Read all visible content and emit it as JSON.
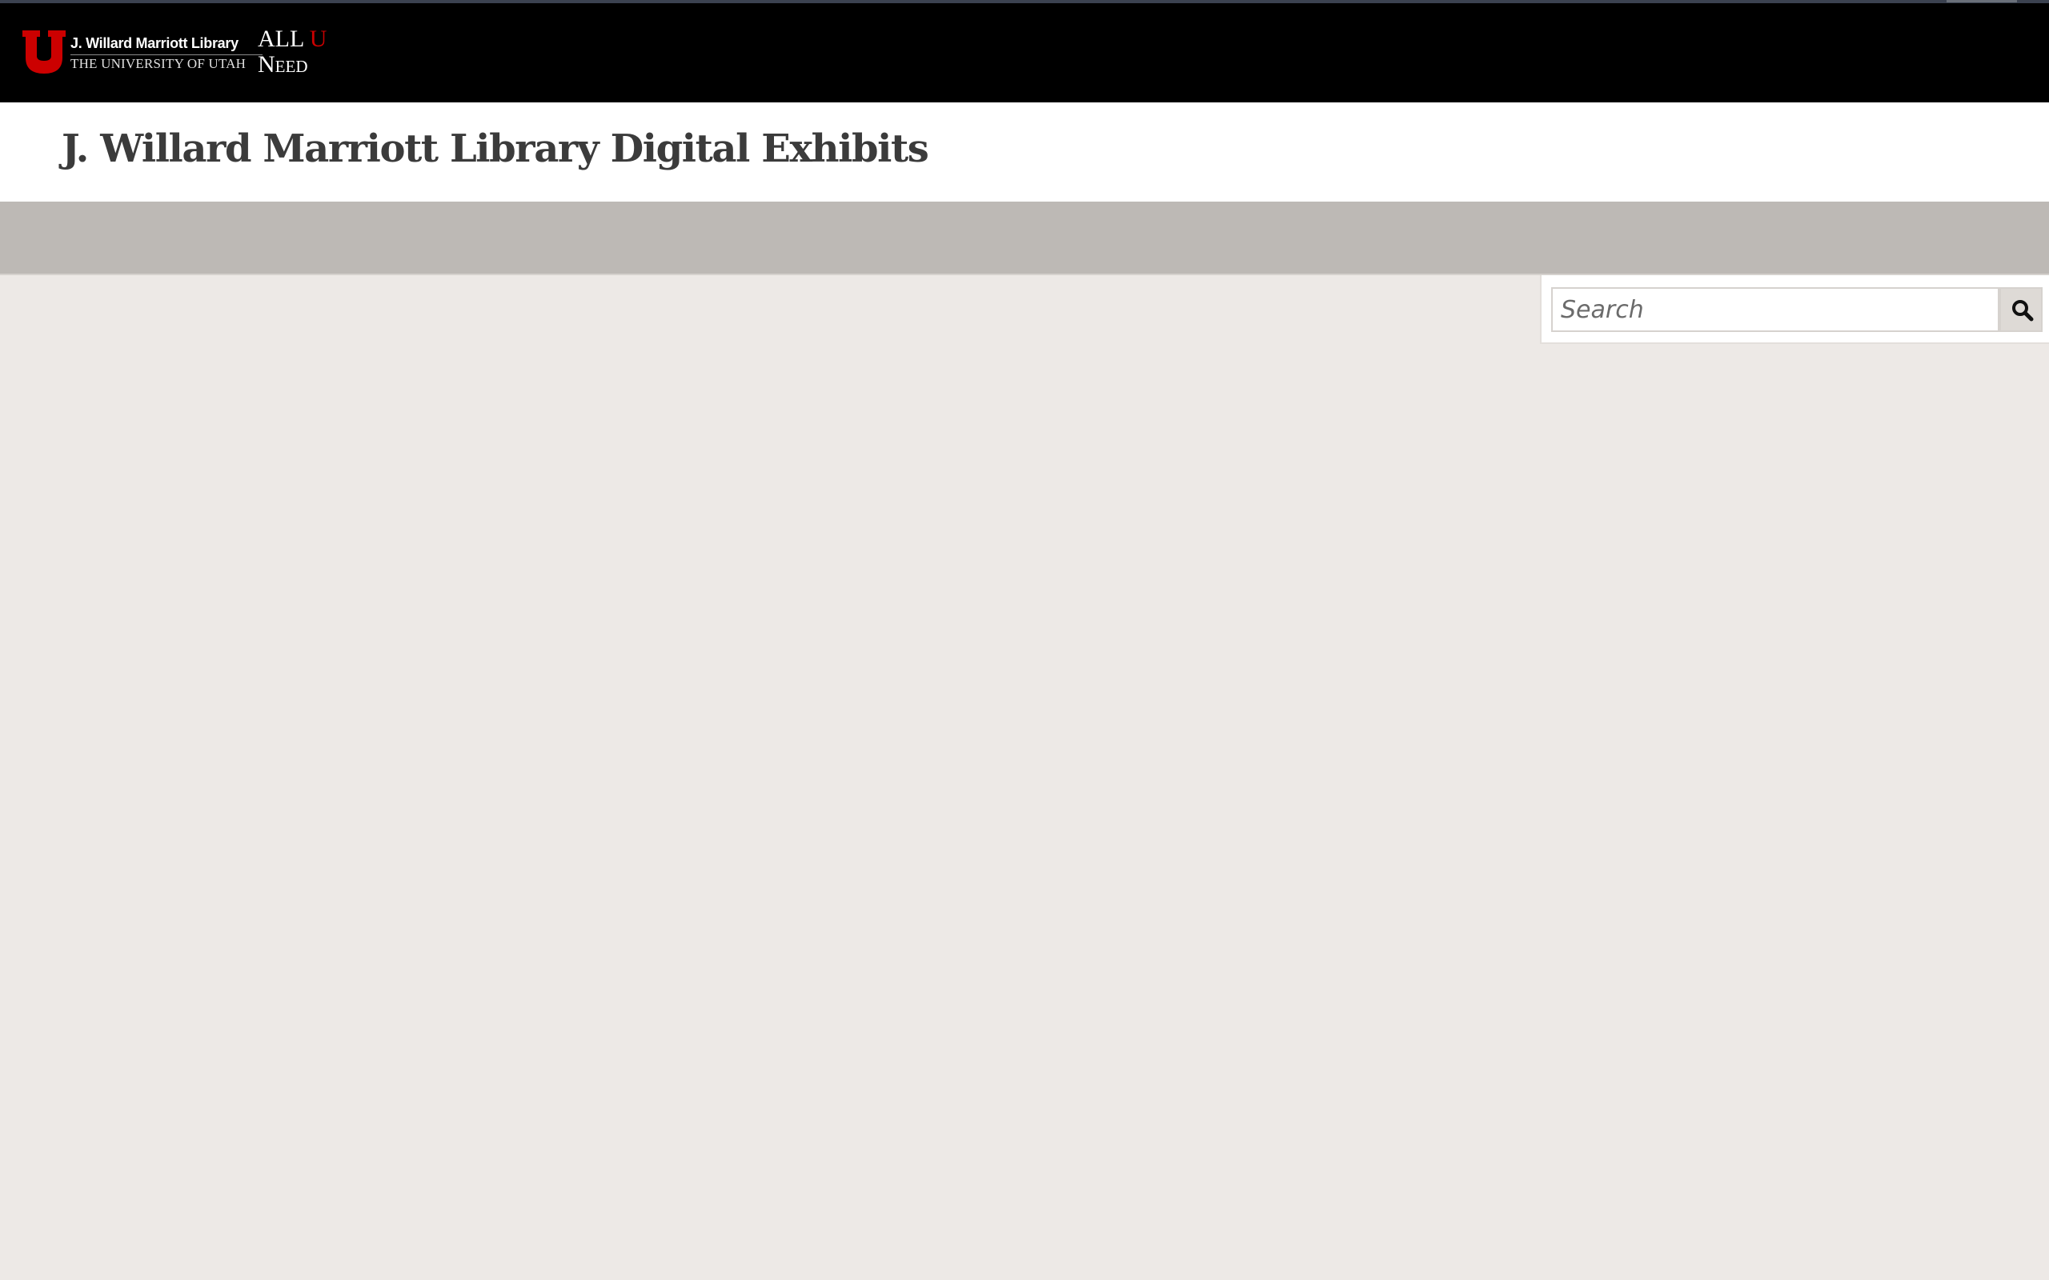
{
  "top_bar": {
    "library_name": "J. Willard Marriott Library",
    "university_name": "THE UNIVERSITY OF UTAH",
    "tagline_all": "ALL",
    "tagline_u": "U",
    "tagline_need": "Need",
    "logo_icon": "university-of-utah-block-u-icon",
    "accent_color": "#cc0000"
  },
  "header": {
    "site_title": "J. Willard Marriott Library Digital Exhibits"
  },
  "search": {
    "placeholder": "Search",
    "value": "",
    "button_icon": "magnifying-glass-icon"
  },
  "colors": {
    "brand_bar": "#000000",
    "nav_bar": "#bdb9b5",
    "page_background": "#ede9e6",
    "title_text": "#3b3b3b"
  }
}
